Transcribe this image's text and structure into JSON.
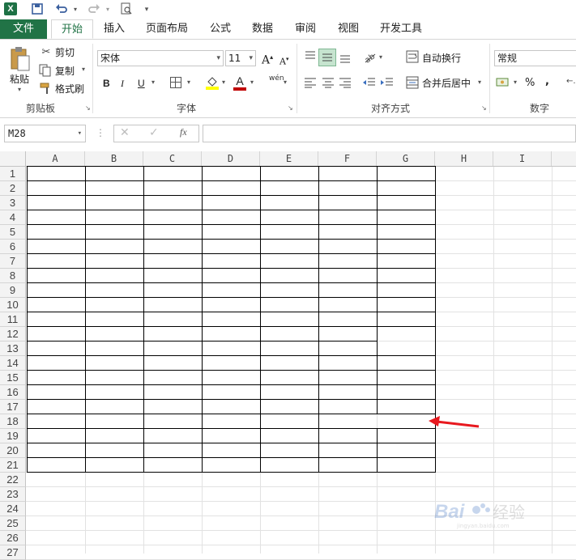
{
  "qat": {
    "app_icon": "X"
  },
  "tabs": [
    "文件",
    "开始",
    "插入",
    "页面布局",
    "公式",
    "数据",
    "审阅",
    "视图",
    "开发工具"
  ],
  "clipboard": {
    "paste": "粘贴",
    "cut": "剪切",
    "copy": "复制",
    "format_painter": "格式刷",
    "group": "剪贴板"
  },
  "font": {
    "name": "宋体",
    "size": "11",
    "group": "字体",
    "bold": "B",
    "italic": "I",
    "underline": "U",
    "grow": "A",
    "shrink": "A",
    "phonetic": "wén"
  },
  "alignment": {
    "wrap": "自动换行",
    "merge": "合并后居中",
    "group": "对齐方式"
  },
  "number": {
    "format": "常规",
    "percent": "%",
    "comma": ",",
    "group": "数字"
  },
  "formula_bar": {
    "name_box": "M28",
    "fx": "fx",
    "value": ""
  },
  "sheet": {
    "columns": [
      "A",
      "B",
      "C",
      "D",
      "E",
      "F",
      "G",
      "H",
      "I"
    ],
    "rows": [
      "1",
      "2",
      "3",
      "4",
      "5",
      "6",
      "7",
      "8",
      "9",
      "10",
      "11",
      "12",
      "13",
      "14",
      "15",
      "16",
      "17",
      "18",
      "19",
      "20",
      "21",
      "22",
      "23",
      "24",
      "25",
      "26",
      "27"
    ]
  },
  "annotation": {
    "arrow_color": "#e8191f"
  },
  "watermark": "Baidu 经验"
}
